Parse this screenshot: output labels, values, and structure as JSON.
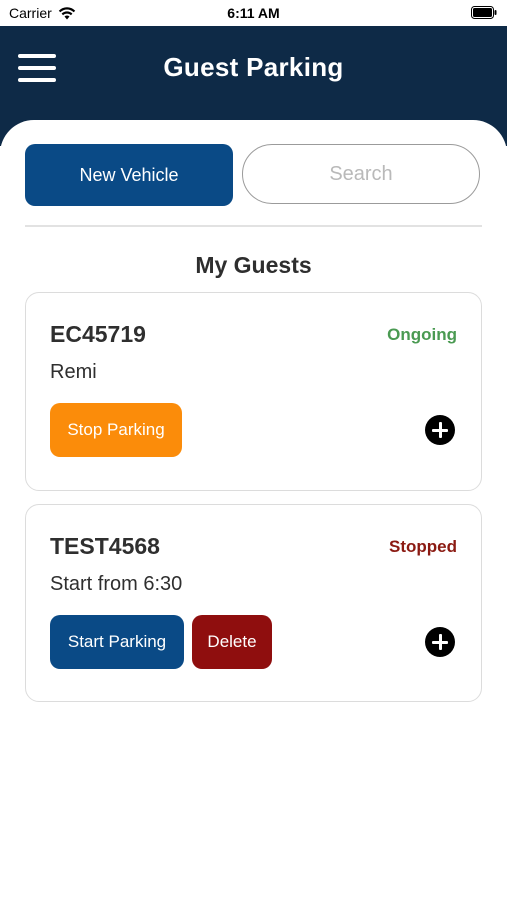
{
  "status_bar": {
    "carrier": "Carrier",
    "time": "6:11 AM",
    "wifi_icon": "wifi-icon",
    "battery_icon": "battery-icon"
  },
  "header": {
    "title": "Guest Parking",
    "menu_icon": "hamburger-menu-icon",
    "background_color": "#0e2a47"
  },
  "toolbar": {
    "new_vehicle_label": "New Vehicle",
    "search_placeholder": "Search"
  },
  "section_title": "My Guests",
  "guests": [
    {
      "plate": "EC45719",
      "status": "Ongoing",
      "status_color": "#4a9a52",
      "subtitle": "Remi",
      "actions": [
        "Stop Parking"
      ],
      "expand_icon": "plus-circle-icon"
    },
    {
      "plate": "TEST4568",
      "status": "Stopped",
      "status_color": "#8b1a12",
      "subtitle": "Start from 6:30",
      "actions": [
        "Start Parking",
        "Delete"
      ],
      "expand_icon": "plus-circle-icon"
    }
  ],
  "colors": {
    "primary": "#0a4a86",
    "stop": "#fb8c0a",
    "delete": "#8f0e0e"
  }
}
